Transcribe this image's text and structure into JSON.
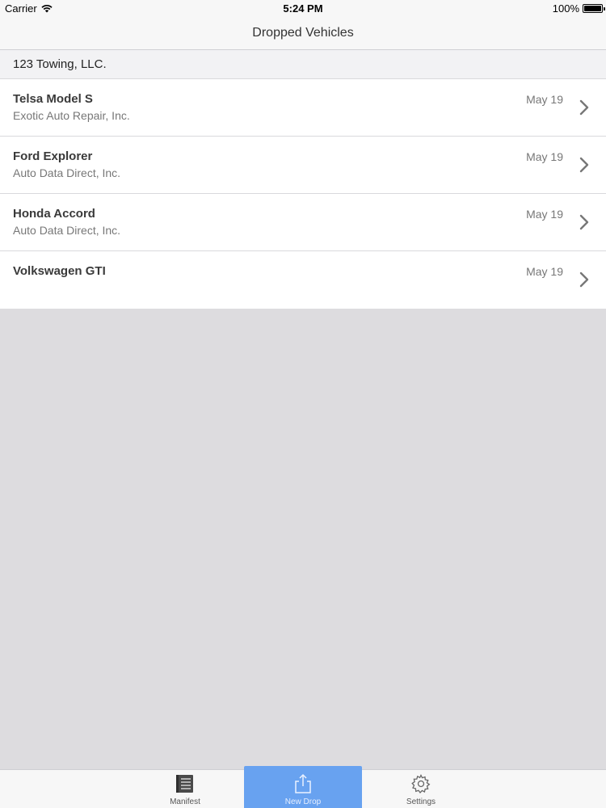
{
  "status_bar": {
    "carrier": "Carrier",
    "time": "5:24 PM",
    "battery": "100%",
    "battery_level": 1.0
  },
  "nav": {
    "title": "Dropped Vehicles"
  },
  "section": {
    "header": "123 Towing, LLC."
  },
  "vehicles": [
    {
      "title": "Telsa Model S",
      "subtitle": "Exotic Auto Repair, Inc.",
      "date": "May 19"
    },
    {
      "title": "Ford Explorer",
      "subtitle": "Auto Data Direct, Inc.",
      "date": "May 19"
    },
    {
      "title": "Honda Accord",
      "subtitle": "Auto Data Direct, Inc.",
      "date": "May 19"
    },
    {
      "title": "Volkswagen GTI",
      "subtitle": "",
      "date": "May 19"
    }
  ],
  "tabs": [
    {
      "label": "Manifest",
      "icon": "manifest-icon",
      "active": false
    },
    {
      "label": "New Drop",
      "icon": "share-icon",
      "active": true
    },
    {
      "label": "Settings",
      "icon": "gear-icon",
      "active": false
    }
  ],
  "colors": {
    "active_tab": "#68a2f0",
    "background": "#dddcdf"
  }
}
